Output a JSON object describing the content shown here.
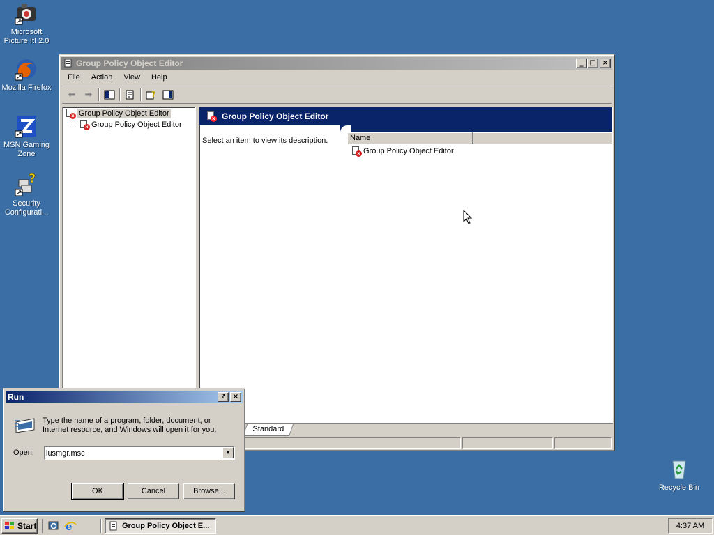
{
  "desktop": {
    "icons": [
      {
        "label": "Microsoft Picture It! 2.0",
        "icon": "picture-it-icon"
      },
      {
        "label": "Mozilla Firefox",
        "icon": "firefox-icon"
      },
      {
        "label": "MSN Gaming Zone",
        "icon": "msn-gaming-zone-icon"
      },
      {
        "label": "Security Configurati...",
        "icon": "security-config-icon"
      },
      {
        "label": "Recycle Bin",
        "icon": "recycle-bin-icon"
      }
    ]
  },
  "gpo_window": {
    "title": "Group Policy Object Editor",
    "menu": [
      "File",
      "Action",
      "View",
      "Help"
    ],
    "tree": {
      "root": "Group Policy Object Editor",
      "child": "Group Policy Object Editor"
    },
    "detail": {
      "banner": "Group Policy Object Editor",
      "description": "Select an item to view its description.",
      "column_name": "Name",
      "items": [
        "Group Policy Object Editor"
      ]
    },
    "tabs": [
      "Standard"
    ]
  },
  "run_dialog": {
    "title": "Run",
    "prompt": "Type the name of a program, folder, document, or Internet resource, and Windows will open it for you.",
    "open_label": "Open:",
    "open_value": "lusmgr.msc",
    "ok": "OK",
    "cancel": "Cancel",
    "browse": "Browse..."
  },
  "taskbar": {
    "start": "Start",
    "task_label": "Group Policy Object E...",
    "clock": "4:37 AM"
  }
}
